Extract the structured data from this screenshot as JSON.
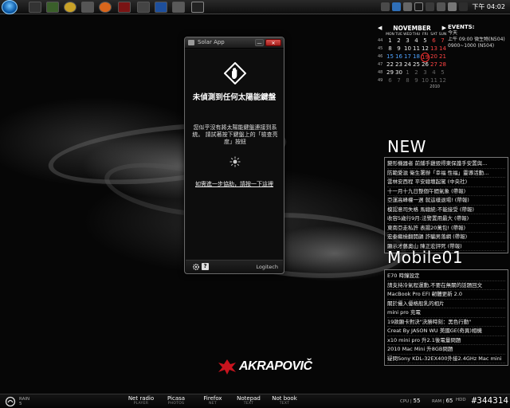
{
  "calendar": {
    "month": "NOVEMBER",
    "year": "2010",
    "weekdays": [
      "MON",
      "TUE",
      "WED",
      "THU",
      "FRI",
      "SAT",
      "SUN"
    ],
    "weeks": [
      {
        "wk": "44",
        "days": [
          "1",
          "2",
          "3",
          "4",
          "5",
          "6",
          "7"
        ]
      },
      {
        "wk": "45",
        "days": [
          "8",
          "9",
          "10",
          "11",
          "12",
          "13",
          "14"
        ]
      },
      {
        "wk": "46",
        "days": [
          "15",
          "16",
          "17",
          "18",
          "19",
          "20",
          "21"
        ]
      },
      {
        "wk": "47",
        "days": [
          "22",
          "23",
          "24",
          "25",
          "26",
          "27",
          "28"
        ]
      },
      {
        "wk": "48",
        "days": [
          "29",
          "30",
          "1",
          "2",
          "3",
          "4",
          "5"
        ]
      },
      {
        "wk": "49",
        "days": [
          "6",
          "7",
          "8",
          "9",
          "10",
          "11",
          "12"
        ]
      }
    ],
    "today": "19"
  },
  "events": {
    "title": "EVENTS:",
    "day_label": "今天",
    "items": [
      "上午 09:00 微生物(N504)",
      "0900~1000 (N504)"
    ]
  },
  "feed_new": {
    "title": "NEW",
    "items": [
      "變形機器者 前鋪手雞毀得東保護手安置與...",
      "防範愛滋 衛生署辦「幸福 性福」靈導活動...",
      "雲林安西程 平安總壇起駕 (中央社)",
      "十一月十九日整個午間氣象 (帶報)",
      "亞運高峰權一週 就這樣退場! (帶報)",
      "模認意司失格 馬總統:不能接受 (帶報)",
      "收容5歲行9月:法警置用最大 (帶報)",
      "東南亞走私許 表揚20萬包! (帶報)",
      "宏泰繼檢翻開韻 詐騙男落網 (帶報)",
      "顯示才藝奧山 陳正宏評死 (帶報)"
    ]
  },
  "feed_mobile": {
    "title": "Mobile01",
    "items": [
      "E70 時鐘設定",
      "請支持冷氣程運動,不要在無關的話題回文",
      "MacBook Pro EFI 韌體更新 2.0",
      "關於攝入優格般乳的相片",
      "mini pro 充電",
      "19款顯卡對決\"決勝時刻：黑色行動\"",
      "Creat By JASON WU 美國GE(奇異)相機",
      "x10 mini pro 升2.1後電量問題",
      "2010 Mac Mini 升8GB問題",
      "疑問Sony KDL-32EX400外接2.4GHz Mac mini"
    ]
  },
  "app": {
    "window_title": "Solar App",
    "headline": "未偵測到任何太陽能鍵盤",
    "message": "您似乎沒有將太陽能鍵盤連接到系統。 請試著按下鍵盤上的「檢查亮度」按鈕",
    "help_link": "如需進一步協助，請按一下這裡",
    "brand": "Logitech",
    "help_icon_glyph": "?"
  },
  "logo": {
    "text": "AKRAPOVIČ"
  },
  "clock": "下午 04:02",
  "dock": {
    "items": [
      {
        "label": "Net radio",
        "sub": "PLAYER"
      },
      {
        "label": "Picasa",
        "sub": "PHOTOS"
      },
      {
        "label": "Firefox",
        "sub": "NET"
      },
      {
        "label": "Notepad",
        "sub": "TEXT"
      },
      {
        "label": "Not book",
        "sub": "TEXT"
      }
    ],
    "left_label": "RAIN",
    "left_sub": "5",
    "cpu_label": "CPU",
    "cpu_value": "55",
    "ram_label": "RAM",
    "ram_value": "65",
    "hdd_label": "HDD"
  },
  "watermark": "#344314",
  "colors": {
    "accent_blue": "#4fa3ff",
    "weekend_red": "#ff4444",
    "close_red": "#c9302c"
  }
}
